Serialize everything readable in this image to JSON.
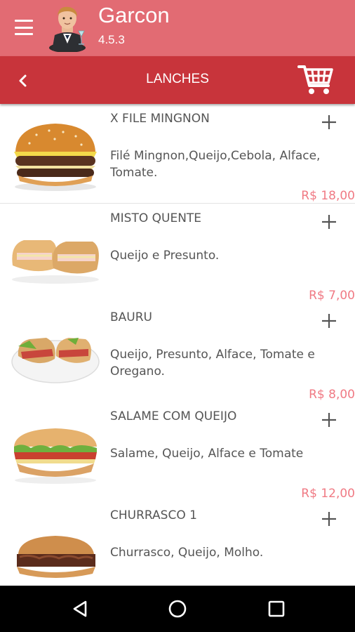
{
  "header": {
    "app_title": "Garcon",
    "app_version": "4.5.3",
    "menu_icon": "hamburger-menu-icon",
    "avatar_icon": "waiter-avatar-icon"
  },
  "toolbar": {
    "title": "LANCHES",
    "back_icon": "chevron-left-icon",
    "cart_icon": "shopping-cart-icon"
  },
  "items": [
    {
      "name": "X FILE MINGNON",
      "description": "Filé Mingnon,Queijo,Cebola, Alface, Tomate.",
      "price": "R$  18,00",
      "image": "burger"
    },
    {
      "name": "MISTO QUENTE",
      "description": "Queijo e Presunto.",
      "price": "R$  7,00",
      "image": "misto"
    },
    {
      "name": "BAURU",
      "description": "Queijo, Presunto, Alface, Tomate e Oregano.",
      "price": "R$  8,00",
      "image": "bauru"
    },
    {
      "name": "SALAME COM QUEIJO",
      "description": "Salame, Queijo, Alface e Tomate",
      "price": "R$  12,00",
      "image": "salame"
    },
    {
      "name": "CHURRASCO 1",
      "description": "Churrasco, Queijo, Molho.",
      "price": "",
      "image": "churrasco"
    }
  ],
  "colors": {
    "appbar": "#e26b73",
    "toolbar": "#c8343b",
    "price": "#f07a84",
    "text": "#555555"
  },
  "navbar": {
    "back_icon": "nav-back-triangle-icon",
    "home_icon": "nav-home-circle-icon",
    "recent_icon": "nav-recent-square-icon"
  }
}
